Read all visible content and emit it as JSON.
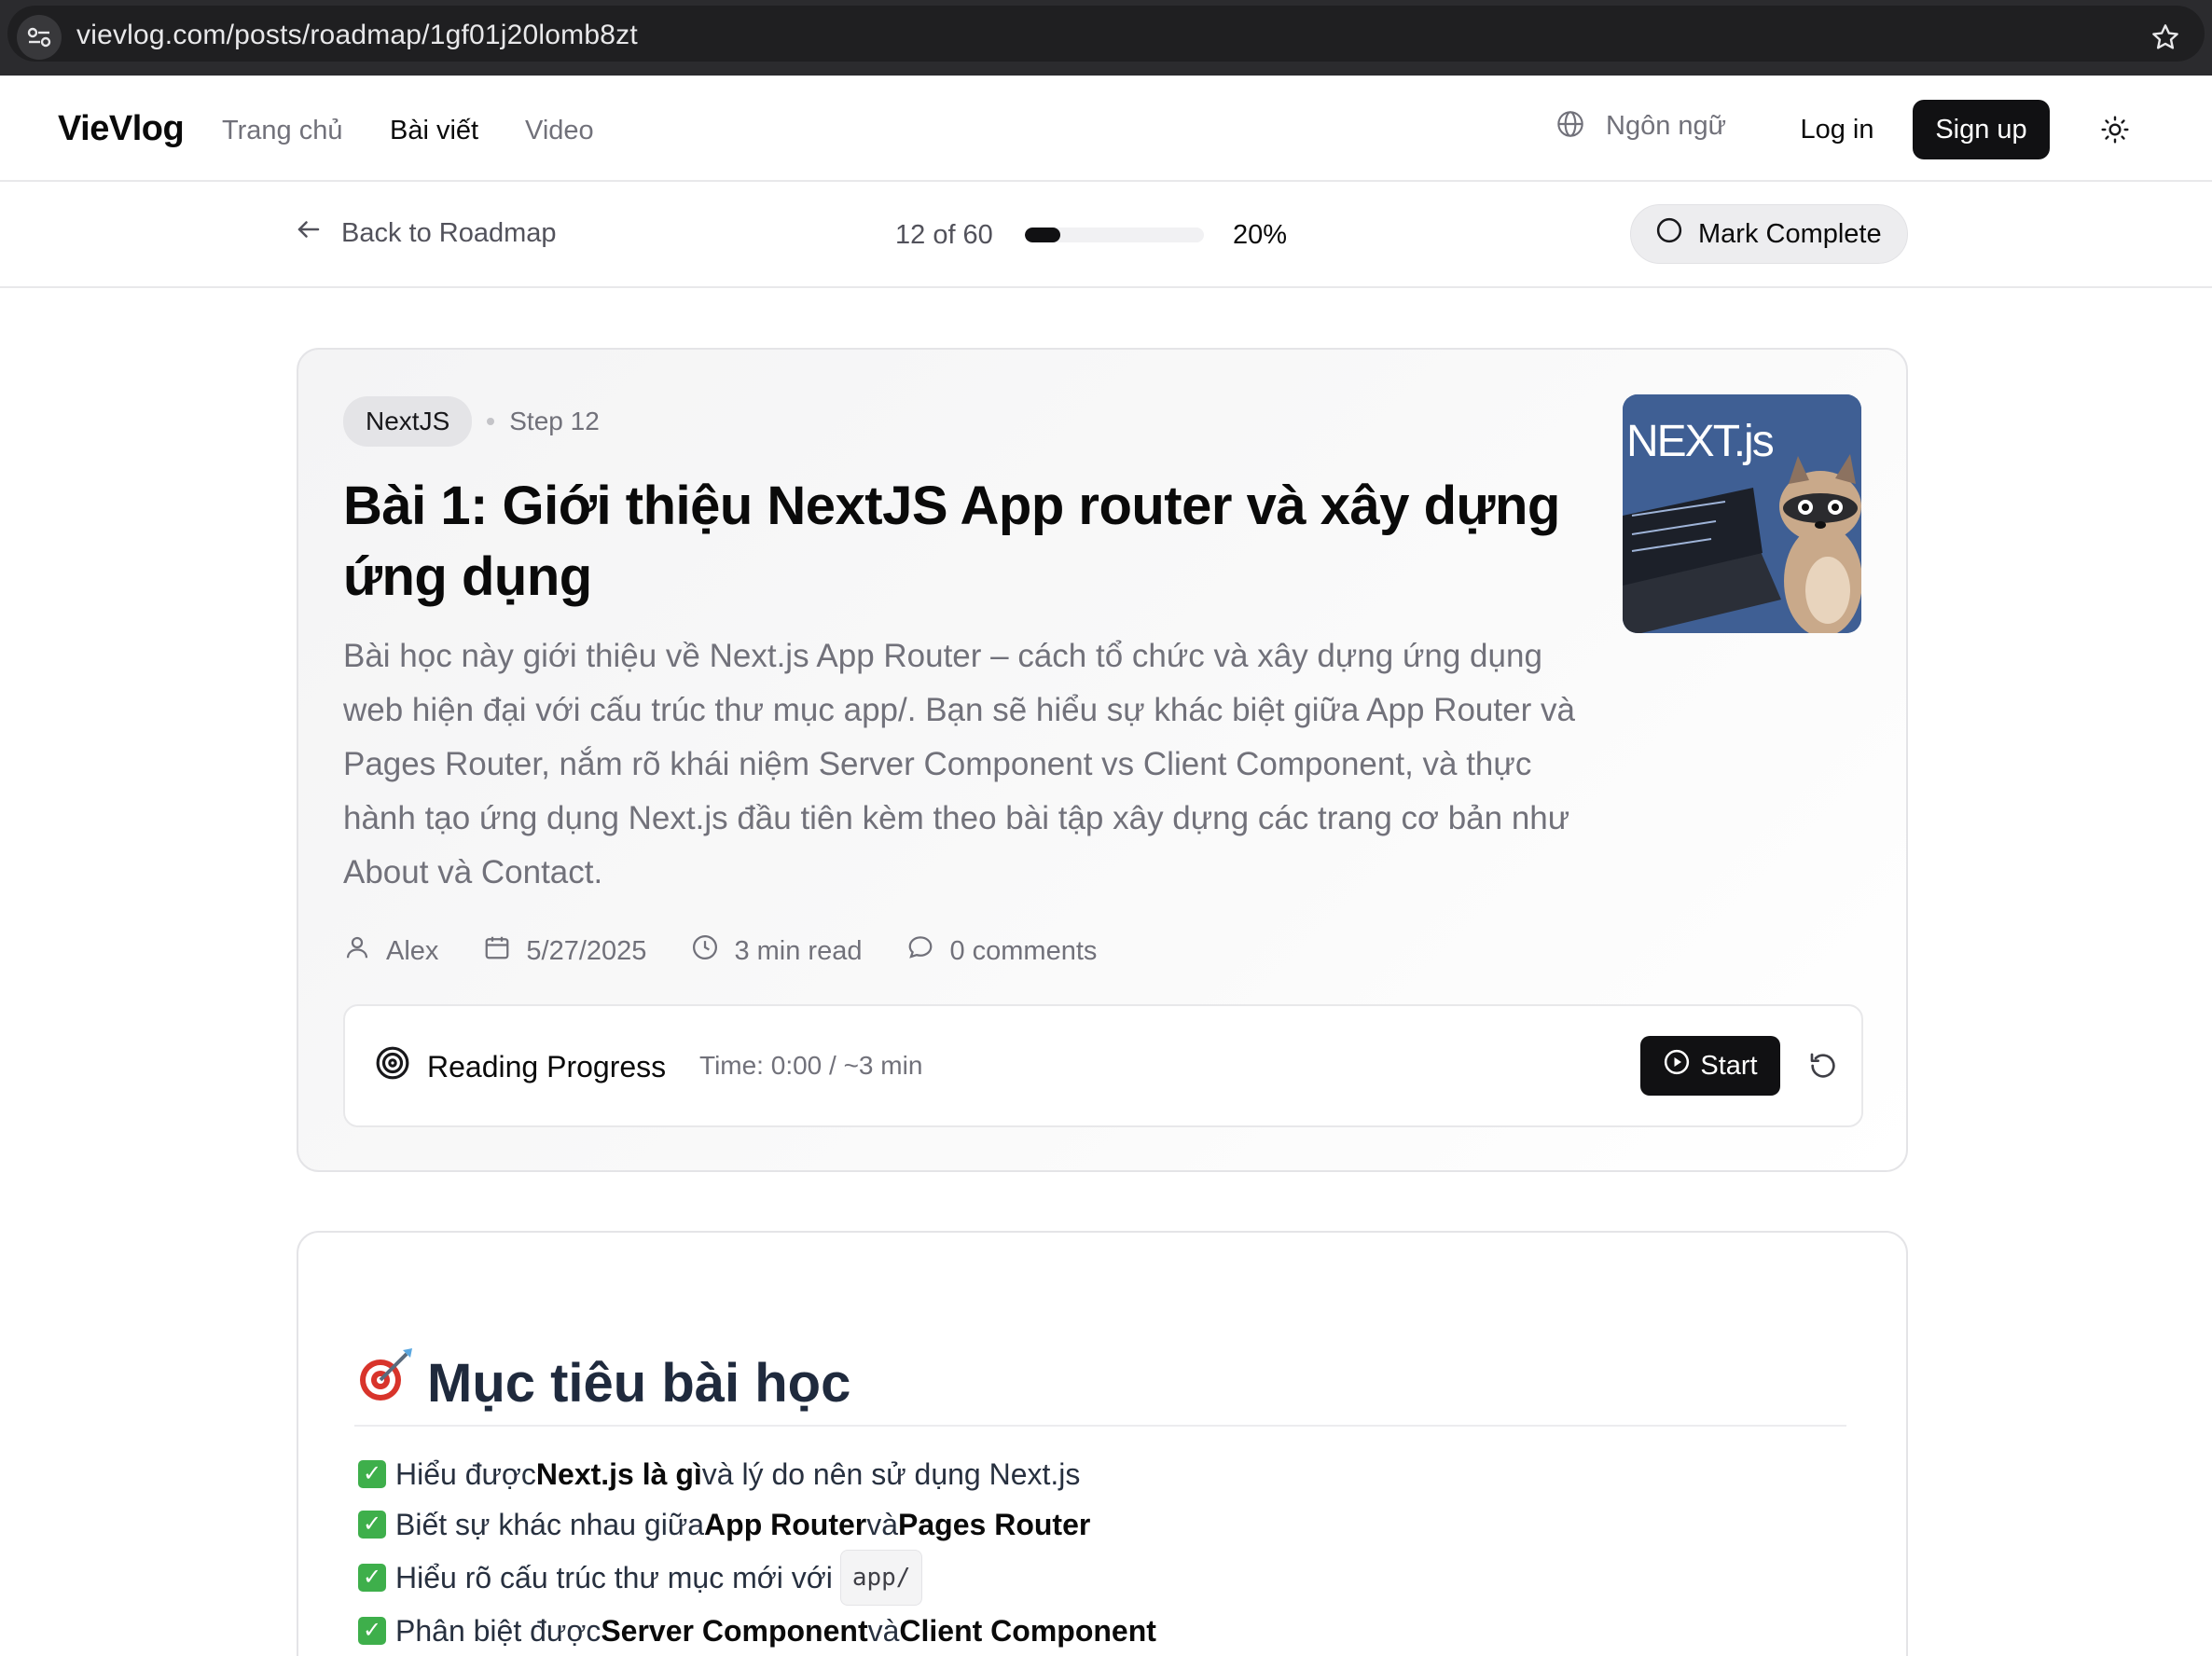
{
  "browser": {
    "url": "vievlog.com/posts/roadmap/1gf01j20lomb8zt"
  },
  "header": {
    "logo": "VieVlog",
    "nav": [
      "Trang chủ",
      "Bài viết",
      "Video"
    ],
    "active_nav": "Bài viết",
    "language_label": "Ngôn ngữ",
    "login_label": "Log in",
    "signup_label": "Sign up"
  },
  "progress_bar": {
    "back_label": "Back to Roadmap",
    "step_text": "12 of 60",
    "percent_text": "20%",
    "percent_value": 20,
    "mark_complete_label": "Mark Complete"
  },
  "post": {
    "tag": "NextJS",
    "step": "Step 12",
    "title": "Bài 1: Giới thiệu NextJS App router và xây dựng ứng dụng",
    "description": "Bài học này giới thiệu về Next.js App Router – cách tổ chức và xây dựng ứng dụng web hiện đại với cấu trúc thư mục app/. Bạn sẽ hiểu sự khác biệt giữa App Router và Pages Router, nắm rõ khái niệm Server Component vs Client Component, và thực hành tạo ứng dụng Next.js đầu tiên kèm theo bài tập xây dựng các trang cơ bản như About và Contact.",
    "thumbnail_text": "NEXT.js",
    "author": "Alex",
    "date": "5/27/2025",
    "read_time": "3 min read",
    "comments": "0 comments"
  },
  "reading": {
    "label": "Reading Progress",
    "time": "Time: 0:00 / ~3 min",
    "start_label": "Start"
  },
  "content": {
    "heading_emoji": "🎯",
    "heading": "Mục tiêu bài học",
    "goals": [
      {
        "pre": "Hiểu được ",
        "bold1": "Next.js là gì",
        "mid": " và lý do nên sử dụng Next.js",
        "bold2": "",
        "post": "",
        "code": ""
      },
      {
        "pre": "Biết sự khác nhau giữa ",
        "bold1": "App Router",
        "mid": " và ",
        "bold2": "Pages Router",
        "post": "",
        "code": ""
      },
      {
        "pre": "Hiểu rõ cấu trúc thư mục mới với",
        "bold1": "",
        "mid": "",
        "bold2": "",
        "post": "",
        "code": "app/"
      },
      {
        "pre": "Phân biệt được ",
        "bold1": "Server Component",
        "mid": " và ",
        "bold2": "Client Component",
        "post": "",
        "code": ""
      }
    ]
  },
  "colors": {
    "primary": "#111113",
    "muted": "#71717a",
    "check_green": "#3eaf4b",
    "thumb_bg": "#3f5f94"
  }
}
